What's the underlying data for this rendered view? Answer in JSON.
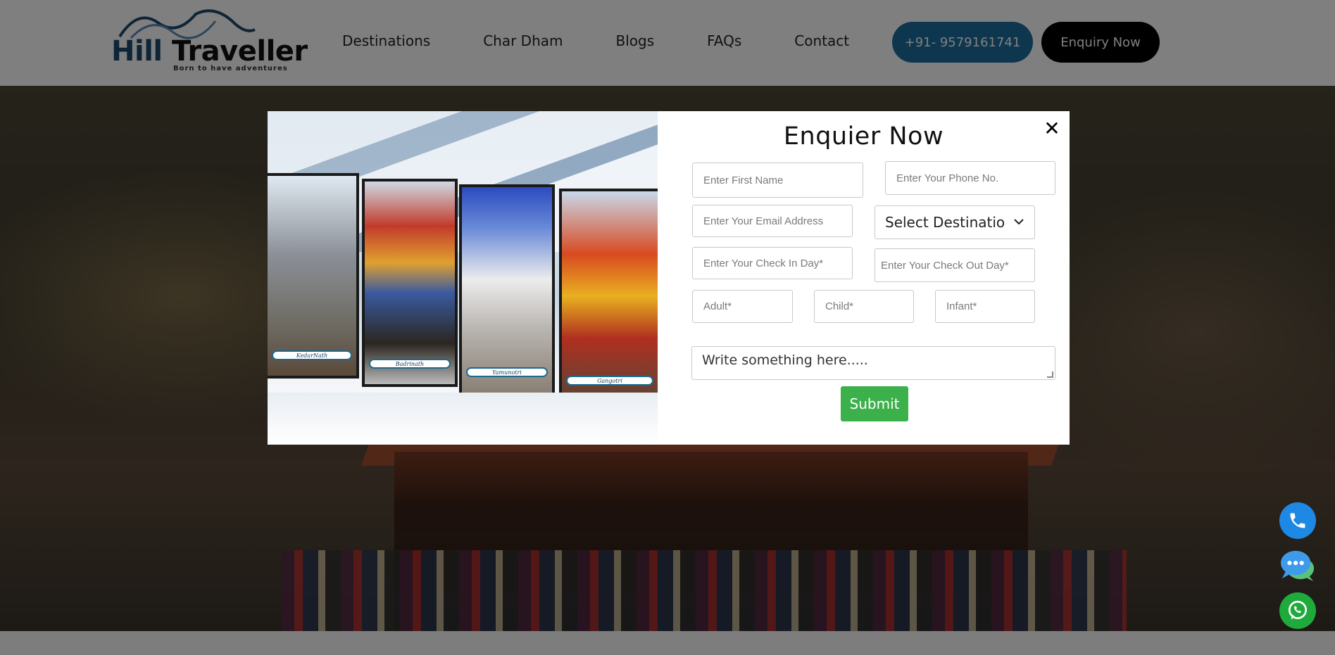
{
  "header": {
    "logo": {
      "brand_first": "Hill",
      "brand_second": "Traveller",
      "tagline": "Born to have adventures"
    },
    "nav": [
      {
        "label": "Destinations"
      },
      {
        "label": "Char Dham"
      },
      {
        "label": "Blogs"
      },
      {
        "label": "FAQs"
      },
      {
        "label": "Contact"
      }
    ],
    "phone_button": "+91- 9579161741",
    "enquiry_button": "Enquiry Now"
  },
  "modal": {
    "title": "Enquier Now",
    "close_icon": "close-icon",
    "image_labels": [
      "KedarNath",
      "Badrinath",
      "Yamunotri",
      "Gangotri"
    ],
    "fields": {
      "first_name": {
        "placeholder": "Enter First Name"
      },
      "phone": {
        "placeholder": "Enter Your Phone No."
      },
      "email": {
        "placeholder": "Enter Your Email Address"
      },
      "destination": {
        "selected": "Select Destinatio"
      },
      "check_in": {
        "placeholder": "Enter Your Check In Day*"
      },
      "check_out": {
        "placeholder": "Enter Your Check Out Day*"
      },
      "adult": {
        "placeholder": "Adult*"
      },
      "child": {
        "placeholder": "Child*"
      },
      "infant": {
        "placeholder": "Infant*"
      },
      "message": {
        "placeholder": "Write something here....."
      }
    },
    "submit_label": "Submit"
  },
  "floating": {
    "call": "phone-icon",
    "chat": "chat-icon",
    "whatsapp": "whatsapp-icon"
  },
  "colors": {
    "phone_button": "#1d6f9e",
    "enquiry_button": "#000000",
    "submit": "#3cb04a",
    "call_fab": "#1e88e5",
    "whatsapp_fab": "#1faa3c",
    "brand": "#1b4b6e"
  }
}
